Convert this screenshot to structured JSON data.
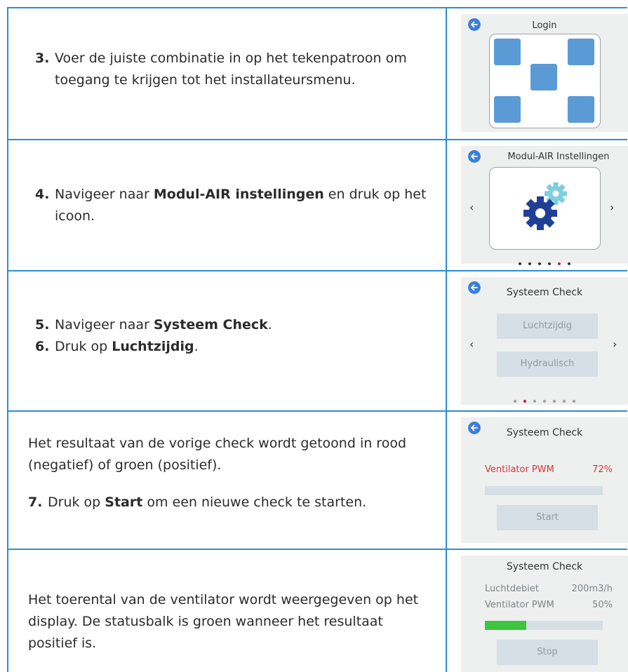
{
  "rows": [
    {
      "steps": [
        {
          "num": "3.",
          "text": "Voer de juiste combinatie in op het tekenpatroon om toegang te krijgen tot het installateursmenu."
        }
      ],
      "screen": {
        "title": "Login",
        "back_icon": "arrow-left-circle-icon"
      }
    },
    {
      "steps": [
        {
          "num": "4.",
          "pre": "Navigeer naar ",
          "bold": "Modul-AIR instellingen",
          "post": " en druk op het icoon."
        }
      ],
      "screen": {
        "title": "Modul-AIR Instellingen",
        "prev": "‹",
        "next": "›",
        "icon": "gears-icon",
        "page": 5,
        "pages": 7
      }
    },
    {
      "steps": [
        {
          "num": "5.",
          "pre": "Navigeer naar ",
          "bold": "Systeem Check",
          "post": "."
        },
        {
          "num": "6.",
          "pre": "Druk op ",
          "bold": "Luchtzijdig",
          "post": "."
        }
      ],
      "screen": {
        "title": "Systeem Check",
        "prev": "‹",
        "next": "›",
        "buttons": [
          "Luchtzijdig",
          "Hydraulisch"
        ],
        "page": 2,
        "pages": 7
      }
    },
    {
      "intro": "Het resultaat van de vorige check wordt getoond in rood (negatief) of groen (positief).",
      "steps": [
        {
          "num": "7.",
          "pre": "Druk op ",
          "bold": "Start",
          "post": " om een nieuwe check te starten."
        }
      ],
      "screen": {
        "title": "Systeem Check",
        "label": "Ventilator PWM",
        "value": "72%",
        "value_color": "#d9343a",
        "progress": 0,
        "button": "Start"
      }
    },
    {
      "intro": "Het toerental van de ventilator wordt weergegeven op het display. De statusbalk is groen wanneer het resultaat positief is.",
      "screen": {
        "title": "Systeem Check",
        "rows": [
          {
            "label": "Luchtdebiet",
            "value": "200m3/h"
          },
          {
            "label": "Ventilator PWM",
            "value": "50%"
          }
        ],
        "progress": 0.35,
        "progress_color": "#3ec43e",
        "button": "Stop"
      }
    }
  ],
  "colors": {
    "border": "#2a8fd0",
    "back_icon": "#3a7fd8",
    "tile": "#5b9bd5",
    "gear_dark": "#1f3f97",
    "gear_light": "#7fcde0"
  }
}
